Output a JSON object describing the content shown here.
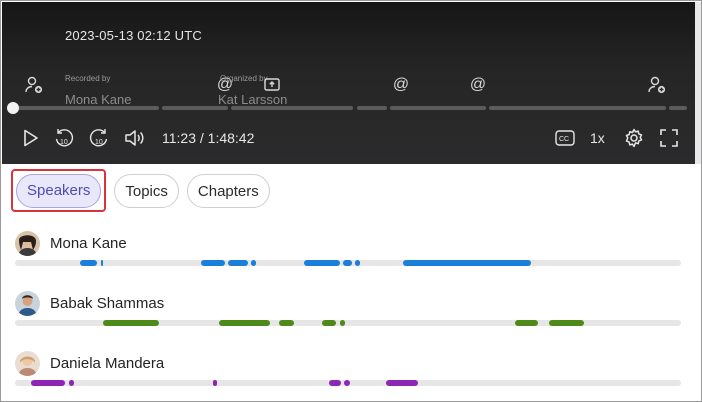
{
  "player": {
    "datetime": "2023-05-13 02:12 UTC",
    "recorded_by_label": "Recorded by",
    "recorded_by_name": "Mona Kane",
    "organized_by_label": "Organized by",
    "organized_by_name": "Kat Larsson",
    "time": "11:23 / 1:48:42",
    "speed": "1x",
    "progress_fraction": 0.0
  },
  "tabs": [
    "Speakers",
    "Topics",
    "Chapters"
  ],
  "speakers": [
    {
      "name": "Mona Kane",
      "color": "#1a7fd8"
    },
    {
      "name": "Babak Shammas",
      "color": "#4d8a1a"
    },
    {
      "name": "Daniela Mandera",
      "color": "#8b26b5"
    }
  ],
  "icons": {
    "marker_person": "person-add-icon",
    "marker_at": "mention-icon",
    "marker_share": "share-screen-icon",
    "play": "play-icon",
    "rewind": "rewind-10-icon",
    "forward": "forward-10-icon",
    "volume": "volume-icon",
    "captions": "captions-icon",
    "settings": "settings-icon",
    "fullscreen": "fullscreen-icon"
  }
}
